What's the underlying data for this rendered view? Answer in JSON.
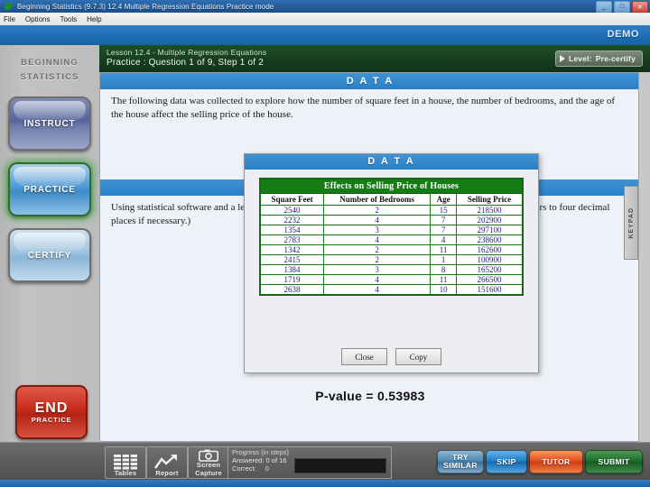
{
  "window": {
    "title": "Beginning Statistics (9.7.3)   12.4 Multiple Regression Equations   Practice mode",
    "minimize": "_",
    "maximize": "□",
    "close": "✕",
    "menu": [
      "File",
      "Options",
      "Tools",
      "Help"
    ]
  },
  "appbar": {
    "demo_label": "DEMO"
  },
  "sidebar": {
    "brand_line1": "BEGINNING",
    "brand_line2": "STATISTICS",
    "buttons": [
      {
        "label": "INSTRUCT"
      },
      {
        "label": "PRACTICE"
      },
      {
        "label": "CERTIFY"
      }
    ],
    "end_button": {
      "line1": "END",
      "line2": "PRACTICE"
    }
  },
  "lesson_header": {
    "line1": "Lesson 12.4 - Multiple Regression Equations",
    "line2": "Practice : Question 1 of 9, Step 1 of 2",
    "level_label": "Level:",
    "level_value": "Pre-certify"
  },
  "content": {
    "section1_title": "D A T A",
    "paragraph1": "The following data was collected to explore how the number of square feet in a house, the number of bedrooms, and the age of the house affect the selling price of the house.",
    "paragraph2": "Using statistical software and a level of significance of 0.05, determine the coefficients. (Round your answers to four decimal places if necessary.)",
    "pvalue": "P-value = 0.53983",
    "keypad_tab": "KEYPAD",
    "keypad_arrow": "‹||"
  },
  "modal": {
    "header": "D A T A",
    "table_caption": "Effects on Selling Price of Houses",
    "columns": [
      "Square Feet",
      "Number of Bedrooms",
      "Age",
      "Selling Price"
    ],
    "rows": [
      [
        "2540",
        "2",
        "15",
        "218500"
      ],
      [
        "2232",
        "4",
        "7",
        "202900"
      ],
      [
        "1354",
        "3",
        "7",
        "297100"
      ],
      [
        "2783",
        "4",
        "4",
        "238600"
      ],
      [
        "1342",
        "2",
        "11",
        "162600"
      ],
      [
        "2415",
        "2",
        "1",
        "100900"
      ],
      [
        "1384",
        "3",
        "8",
        "165200"
      ],
      [
        "1719",
        "4",
        "11",
        "266500"
      ],
      [
        "2638",
        "4",
        "10",
        "151600"
      ]
    ],
    "close_label": "Close",
    "copy_label": "Copy"
  },
  "bottom": {
    "tools": [
      {
        "label": "Tables",
        "icon": "table-icon"
      },
      {
        "label": "Report",
        "icon": "chart-line-icon"
      },
      {
        "label2": "Screen",
        "label3": "Capture",
        "icon": "camera-icon"
      }
    ],
    "progress_title": "Progress (in steps)",
    "answered_label": "Answered:",
    "answered_value": "0 of 16",
    "correct_label": "Correct:",
    "correct_value": "0",
    "actions": [
      {
        "label": "TRY SIMILAR"
      },
      {
        "label": "SKIP"
      },
      {
        "label": "TUTOR"
      },
      {
        "label": "SUBMIT"
      }
    ]
  }
}
